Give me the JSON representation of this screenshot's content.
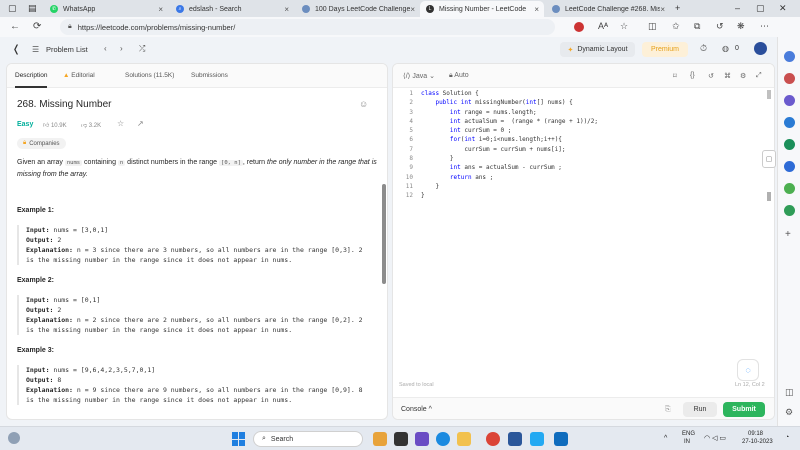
{
  "browser": {
    "tabs": [
      {
        "label": "WhatsApp",
        "color": "#25d366"
      },
      {
        "label": "edslash - Search",
        "color": "#3b78e7"
      },
      {
        "label": "100 Days LeetCode Challenge - C",
        "color": "#6c8ebf"
      },
      {
        "label": "Missing Number - LeetCode",
        "color": "#ffa116"
      },
      {
        "label": "LeetCode Challenge #268. Missi",
        "color": "#6c8ebf"
      }
    ],
    "url": "https://leetcode.com/problems/missing-number/",
    "zoom_badge": "Aᴬ"
  },
  "nav": {
    "problem_list": "Problem List",
    "dynamic_layout": "Dynamic Layout",
    "premium": "Premium",
    "streak_count": "0"
  },
  "left": {
    "tabs": [
      "Description",
      "Editorial",
      "Solutions (11.5K)",
      "Submissions"
    ],
    "title": "268. Missing Number",
    "difficulty": "Easy",
    "likes": "10.9K",
    "dislikes": "3.2K",
    "companies": "Companies",
    "desc": {
      "p1": "Given an array ",
      "c1": "nums",
      "p2": " containing ",
      "c2": "n",
      "p3": " distinct numbers in the range ",
      "c3": "[0, n]",
      "p4": ", return ",
      "em": "the only number in the range that is missing from the array."
    },
    "examples": [
      {
        "heading": "Example 1:",
        "input": "nums = [3,0,1]",
        "output": "2",
        "explanation": "n = 3 since there are 3 numbers, so all numbers are in the range [0,3]. 2 is the missing number in the range since it does not appear in nums."
      },
      {
        "heading": "Example 2:",
        "input": "nums = [0,1]",
        "output": "2",
        "explanation": "n = 2 since there are 2 numbers, so all numbers are in the range [0,2]. 2 is the missing number in the range since it does not appear in nums."
      },
      {
        "heading": "Example 3:",
        "input": "nums = [9,6,4,2,3,5,7,0,1]",
        "output": "8",
        "explanation": "n = 9 since there are 9 numbers, so all numbers are in the range [0,9]. 8 is the missing number in the range since it does not appear in nums."
      }
    ],
    "labels": {
      "input": "Input:",
      "output": "Output:",
      "explanation": "Explanation:"
    }
  },
  "editor": {
    "language": "Java",
    "auto": "Auto",
    "lines": [
      "class Solution {",
      "    public int missingNumber(int[] nums) {",
      "        int range = nums.length;",
      "        int actualSum =  (range * (range + 1))/2;",
      "        int currSum = 0 ;",
      "        for(int i=0;i<nums.length;i++){",
      "            currSum = currSum + nums[i];",
      "        }",
      "        int ans = actualSum - currSum ;",
      "        return ans ;",
      "    }",
      "}"
    ],
    "saved": "Saved to local",
    "position": "Ln 12, Col 2",
    "console": "Console",
    "run": "Run",
    "submit": "Submit"
  },
  "taskbar": {
    "search": "Search",
    "lang1": "ENG",
    "lang2": "IN",
    "time": "09:18",
    "date": "27-10-2023"
  }
}
